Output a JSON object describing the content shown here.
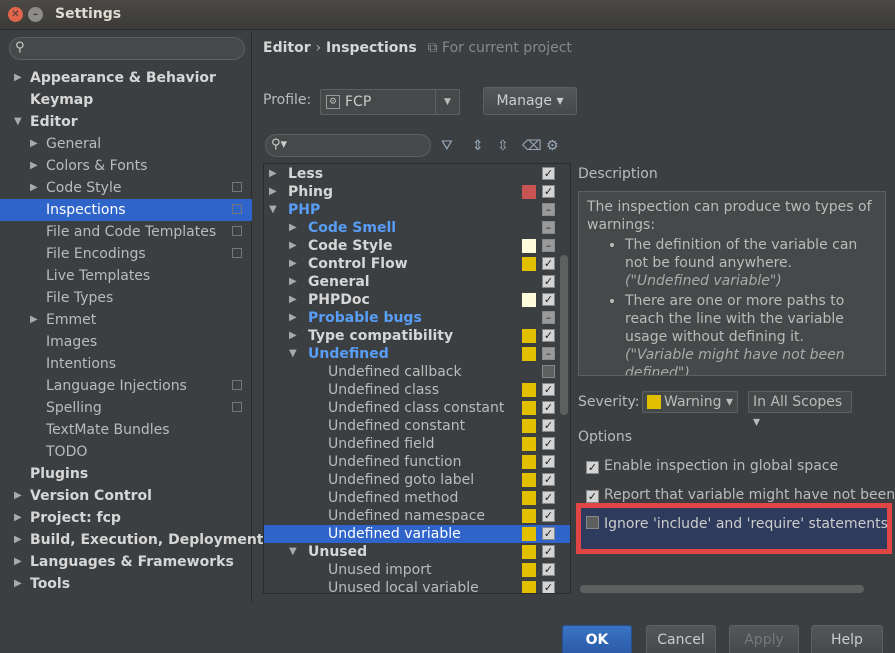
{
  "window": {
    "title": "Settings"
  },
  "sidebar": {
    "search_placeholder": "",
    "items": [
      {
        "label": "Appearance & Behavior",
        "level": 0,
        "arrow": "▶",
        "bold": true
      },
      {
        "label": "Keymap",
        "level": 0,
        "arrow": "",
        "bold": true
      },
      {
        "label": "Editor",
        "level": 0,
        "arrow": "▼",
        "bold": true
      },
      {
        "label": "General",
        "level": 1,
        "arrow": "▶"
      },
      {
        "label": "Colors & Fonts",
        "level": 1,
        "arrow": "▶"
      },
      {
        "label": "Code Style",
        "level": 1,
        "arrow": "▶",
        "copy": true
      },
      {
        "label": "Inspections",
        "level": 1,
        "arrow": "",
        "copy": true,
        "selected": true
      },
      {
        "label": "File and Code Templates",
        "level": 1,
        "arrow": "",
        "copy": true
      },
      {
        "label": "File Encodings",
        "level": 1,
        "arrow": "",
        "copy": true
      },
      {
        "label": "Live Templates",
        "level": 1,
        "arrow": ""
      },
      {
        "label": "File Types",
        "level": 1,
        "arrow": ""
      },
      {
        "label": "Emmet",
        "level": 1,
        "arrow": "▶"
      },
      {
        "label": "Images",
        "level": 1,
        "arrow": ""
      },
      {
        "label": "Intentions",
        "level": 1,
        "arrow": ""
      },
      {
        "label": "Language Injections",
        "level": 1,
        "arrow": "",
        "copy": true
      },
      {
        "label": "Spelling",
        "level": 1,
        "arrow": "",
        "copy": true
      },
      {
        "label": "TextMate Bundles",
        "level": 1,
        "arrow": ""
      },
      {
        "label": "TODO",
        "level": 1,
        "arrow": ""
      },
      {
        "label": "Plugins",
        "level": 0,
        "arrow": "",
        "bold": true
      },
      {
        "label": "Version Control",
        "level": 0,
        "arrow": "▶",
        "bold": true
      },
      {
        "label": "Project: fcp",
        "level": 0,
        "arrow": "▶",
        "bold": true
      },
      {
        "label": "Build, Execution, Deployment",
        "level": 0,
        "arrow": "▶",
        "bold": true
      },
      {
        "label": "Languages & Frameworks",
        "level": 0,
        "arrow": "▶",
        "bold": true
      },
      {
        "label": "Tools",
        "level": 0,
        "arrow": "▶",
        "bold": true
      }
    ]
  },
  "header": {
    "crumb1": "Editor",
    "sep": "›",
    "crumb2": "Inspections",
    "project_note": "For current project"
  },
  "profile": {
    "label": "Profile:",
    "value": "FCP",
    "manage": "Manage"
  },
  "inspections": [
    {
      "label": "Less",
      "level": 0,
      "arrow": "▶",
      "bold": true,
      "swatch": "",
      "check": "on"
    },
    {
      "label": "Phing",
      "level": 0,
      "arrow": "▶",
      "bold": true,
      "swatch": "#c75450",
      "check": "on"
    },
    {
      "label": "PHP",
      "level": 0,
      "arrow": "▼",
      "blue": true,
      "swatch": "",
      "check": "dash"
    },
    {
      "label": "Code Smell",
      "level": 1,
      "arrow": "▶",
      "blue": true,
      "swatch": "",
      "check": "dash"
    },
    {
      "label": "Code Style",
      "level": 1,
      "arrow": "▶",
      "bold": true,
      "swatch": "#fffbdb",
      "check": "dash"
    },
    {
      "label": "Control Flow",
      "level": 1,
      "arrow": "▶",
      "bold": true,
      "swatch": "#e2c000",
      "check": "on"
    },
    {
      "label": "General",
      "level": 1,
      "arrow": "▶",
      "bold": true,
      "swatch": "",
      "check": "on"
    },
    {
      "label": "PHPDoc",
      "level": 1,
      "arrow": "▶",
      "bold": true,
      "swatch": "#fffbdb",
      "check": "on"
    },
    {
      "label": "Probable bugs",
      "level": 1,
      "arrow": "▶",
      "blue": true,
      "swatch": "",
      "check": "dash"
    },
    {
      "label": "Type compatibility",
      "level": 1,
      "arrow": "▶",
      "bold": true,
      "swatch": "#e2c000",
      "check": "on"
    },
    {
      "label": "Undefined",
      "level": 1,
      "arrow": "▼",
      "blue": true,
      "swatch": "#e2c000",
      "check": "dash"
    },
    {
      "label": "Undefined callback",
      "level": 2,
      "arrow": "",
      "swatch": "",
      "check": "off"
    },
    {
      "label": "Undefined class",
      "level": 2,
      "arrow": "",
      "swatch": "#e2c000",
      "check": "on"
    },
    {
      "label": "Undefined class constant",
      "level": 2,
      "arrow": "",
      "swatch": "#e2c000",
      "check": "on"
    },
    {
      "label": "Undefined constant",
      "level": 2,
      "arrow": "",
      "swatch": "#e2c000",
      "check": "on"
    },
    {
      "label": "Undefined field",
      "level": 2,
      "arrow": "",
      "swatch": "#e2c000",
      "check": "on"
    },
    {
      "label": "Undefined function",
      "level": 2,
      "arrow": "",
      "swatch": "#e2c000",
      "check": "on"
    },
    {
      "label": "Undefined goto label",
      "level": 2,
      "arrow": "",
      "swatch": "#e2c000",
      "check": "on"
    },
    {
      "label": "Undefined method",
      "level": 2,
      "arrow": "",
      "swatch": "#e2c000",
      "check": "on"
    },
    {
      "label": "Undefined namespace",
      "level": 2,
      "arrow": "",
      "swatch": "#e2c000",
      "check": "on"
    },
    {
      "label": "Undefined variable",
      "level": 2,
      "arrow": "",
      "swatch": "#e2c000",
      "check": "on",
      "selected": true
    },
    {
      "label": "Unused",
      "level": 1,
      "arrow": "▼",
      "bold": true,
      "swatch": "#e2c000",
      "check": "on"
    },
    {
      "label": "Unused import",
      "level": 2,
      "arrow": "",
      "swatch": "#e2c000",
      "check": "on"
    },
    {
      "label": "Unused local variable",
      "level": 2,
      "arrow": "",
      "swatch": "#e2c000",
      "check": "on"
    }
  ],
  "description": {
    "label": "Description",
    "intro": "The inspection can produce two types of warnings:",
    "bullet1": "The definition of the variable can not be found anywhere.",
    "bullet1_quote": "(\"Undefined variable\")",
    "bullet2": "There are one or more paths to reach the line with the variable usage without defining it.",
    "bullet2_quote": "(\"Variable might have not been defined\")"
  },
  "severity": {
    "label": "Severity:",
    "value": "Warning",
    "scope": "In All Scopes"
  },
  "options": {
    "label": "Options",
    "opt1": "Enable inspection in global space",
    "opt2": "Report that variable might have not been",
    "opt3": "Ignore 'include' and 'require' statements"
  },
  "buttons": {
    "ok": "OK",
    "cancel": "Cancel",
    "apply": "Apply",
    "help": "Help"
  },
  "colors": {
    "accent": "#2f65ca",
    "highlight_border": "#e24545",
    "warning": "#e2c000"
  }
}
